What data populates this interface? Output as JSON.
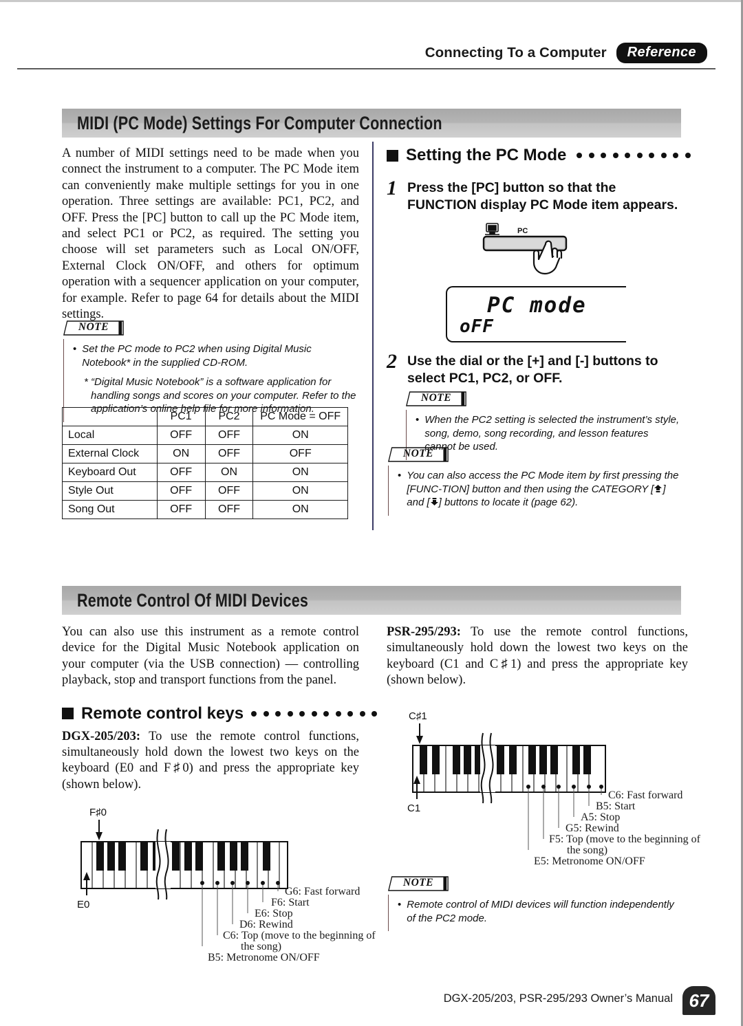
{
  "header": {
    "title": "Connecting To a Computer",
    "tab": "Reference"
  },
  "sections": {
    "midi": {
      "bar_title": "MIDI (PC Mode) Settings For Computer Connection",
      "intro": "A number of MIDI settings need to be made when you connect the instrument to a computer. The PC Mode item can conveniently make multiple settings for you in one operation. Three settings are available: PC1, PC2, and OFF. Press the [PC] button to call up the PC Mode item, and select PC1 or PC2, as required. The setting you choose will set parameters such as Local ON/OFF, External Clock ON/OFF, and others for optimum operation with a sequencer application on your computer, for example. Refer to page 64 for details about the MIDI settings.",
      "note1": {
        "label": "NOTE",
        "bullet": "Set the PC mode to PC2 when using Digital Music Notebook* in the supplied CD-ROM.",
        "sub": "* “Digital Music Notebook” is a software application for handling songs and scores on your computer. Refer to the application’s online help file for more information."
      },
      "table": {
        "headers": [
          "",
          "PC1",
          "PC2",
          "PC Mode = OFF"
        ],
        "rows": [
          {
            "label": "Local",
            "pc1": "OFF",
            "pc2": "OFF",
            "off": "ON"
          },
          {
            "label": "External Clock",
            "pc1": "ON",
            "pc2": "OFF",
            "off": "OFF"
          },
          {
            "label": "Keyboard Out",
            "pc1": "OFF",
            "pc2": "ON",
            "off": "ON"
          },
          {
            "label": "Style Out",
            "pc1": "OFF",
            "pc2": "OFF",
            "off": "ON"
          },
          {
            "label": "Song Out",
            "pc1": "OFF",
            "pc2": "OFF",
            "off": "ON"
          }
        ]
      },
      "setting_pc_mode": {
        "subhead": "Setting the PC Mode",
        "dots": 10,
        "step1_num": "1",
        "step1_text": "Press the [PC] button so that the FUNCTION display PC Mode item appears.",
        "button_label": "PC",
        "lcd_line1": "PC mode",
        "lcd_line2": "oFF",
        "step2_num": "2",
        "step2_text": "Use the dial or the [+] and [-] buttons to select PC1, PC2, or OFF.",
        "note2": {
          "label": "NOTE",
          "bullet": "When the PC2 setting is selected the instrument’s style, song, demo, song recording, and lesson features cannot be used."
        },
        "note3": {
          "label": "NOTE",
          "bullet_a": "You can also access the PC Mode item by first pressing the [FUNC-TION] button and then using the CATEGORY [",
          "bullet_b": "] and [",
          "bullet_c": "] buttons to locate it (page 62)."
        }
      }
    },
    "remote": {
      "bar_title": "Remote Control Of MIDI Devices",
      "intro": "You can also use this instrument as a remote control device for the Digital Music Notebook application on your computer (via the USB connection) — controlling playback, stop and transport functions from the panel.",
      "subhead": "Remote control keys",
      "dots": 11,
      "dgx": {
        "model": "DGX-205/203:",
        "text": " To use the remote control functions, simultaneously hold down the lowest two keys on the keyboard (E0 and F♯0) and press the appropriate key (shown below).",
        "diagram": {
          "top_note": "F♯0",
          "bottom_note": "E0",
          "callouts": [
            "G6: Fast forward",
            "F6: Start",
            "E6: Stop",
            "D6: Rewind",
            "C6: Top (move to the beginning of",
            "the song)",
            "B5: Metronome ON/OFF"
          ]
        }
      },
      "psr": {
        "model": "PSR-295/293:",
        "text": " To use the remote control functions, simultaneously hold down the lowest two keys on the keyboard (C1 and C♯1) and press the appropriate key (shown below).",
        "diagram": {
          "top_note": "C♯1",
          "bottom_note": "C1",
          "callouts": [
            "C6: Fast forward",
            "B5: Start",
            "A5: Stop",
            "G5: Rewind",
            "F5: Top (move to the beginning of",
            "the song)",
            "E5: Metronome ON/OFF"
          ]
        }
      },
      "note4": {
        "label": "NOTE",
        "bullet": "Remote control of MIDI devices will function independently of the PC2 mode."
      }
    }
  },
  "footer": {
    "text": "DGX-205/203, PSR-295/293  Owner’s Manual",
    "page": "67"
  }
}
